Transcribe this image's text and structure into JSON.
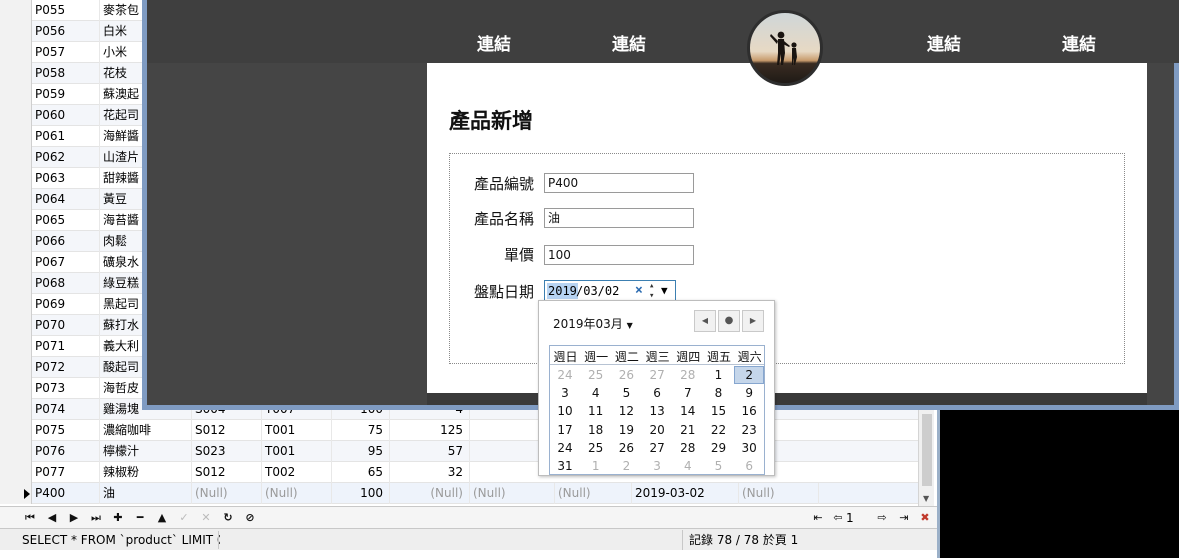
{
  "db_grid": {
    "rows": [
      {
        "id": "P055",
        "name": "麥茶包"
      },
      {
        "id": "P056",
        "name": "白米"
      },
      {
        "id": "P057",
        "name": "小米"
      },
      {
        "id": "P058",
        "name": "花枝"
      },
      {
        "id": "P059",
        "name": "蘇澳起"
      },
      {
        "id": "P060",
        "name": "花起司"
      },
      {
        "id": "P061",
        "name": "海鮮醬"
      },
      {
        "id": "P062",
        "name": "山渣片"
      },
      {
        "id": "P063",
        "name": "甜辣醬"
      },
      {
        "id": "P064",
        "name": "黃豆"
      },
      {
        "id": "P065",
        "name": "海苔醬"
      },
      {
        "id": "P066",
        "name": "肉鬆"
      },
      {
        "id": "P067",
        "name": "礦泉水"
      },
      {
        "id": "P068",
        "name": "綠豆糕"
      },
      {
        "id": "P069",
        "name": "黑起司"
      },
      {
        "id": "P070",
        "name": "蘇打水"
      },
      {
        "id": "P071",
        "name": "義大利"
      },
      {
        "id": "P072",
        "name": "酸起司"
      },
      {
        "id": "P073",
        "name": "海哲皮"
      },
      {
        "id": "P074",
        "name": "雞湯塊",
        "c3": "S004",
        "c4": "T007",
        "c5": "100",
        "c6": "4"
      },
      {
        "id": "P075",
        "name": "濃縮咖啡",
        "c3": "S012",
        "c4": "T001",
        "c5": "75",
        "c6": "125"
      },
      {
        "id": "P076",
        "name": "檸檬汁",
        "c3": "S023",
        "c4": "T001",
        "c5": "95",
        "c6": "57"
      },
      {
        "id": "P077",
        "name": "辣椒粉",
        "c3": "S012",
        "c4": "T002",
        "c5": "65",
        "c6": "32"
      },
      {
        "id": "P400",
        "name": "油",
        "c3": "(Null)",
        "c4": "(Null)",
        "c5": "100",
        "c6": "(Null)",
        "c7": "(Null)",
        "c8": "(Null)",
        "c9": "2019-03-02",
        "c10": "(Null)"
      }
    ],
    "page_number": "1",
    "sql_text": "SELECT * FROM `product` LIMIT 0, :",
    "record_text": "記錄 78 / 78 於頁 1"
  },
  "browser": {
    "nav_links": [
      "連結",
      "連結",
      "連結",
      "連結"
    ],
    "form_title": "產品新增",
    "fields": {
      "product_id_label": "產品編號",
      "product_id_value": "P400",
      "product_name_label": "產品名稱",
      "product_name_value": "油",
      "price_label": "單價",
      "price_value": "100",
      "stock_date_label": "盤點日期",
      "stock_date_year": "2019",
      "stock_date_rest": "/03/02"
    }
  },
  "calendar": {
    "month_label": "2019年03月",
    "weekdays": [
      "週日",
      "週一",
      "週二",
      "週三",
      "週四",
      "週五",
      "週六"
    ],
    "weeks": [
      [
        "24",
        "25",
        "26",
        "27",
        "28",
        "1",
        "2"
      ],
      [
        "3",
        "4",
        "5",
        "6",
        "7",
        "8",
        "9"
      ],
      [
        "10",
        "11",
        "12",
        "13",
        "14",
        "15",
        "16"
      ],
      [
        "17",
        "18",
        "19",
        "20",
        "21",
        "22",
        "23"
      ],
      [
        "24",
        "25",
        "26",
        "27",
        "28",
        "29",
        "30"
      ],
      [
        "31",
        "1",
        "2",
        "3",
        "4",
        "5",
        "6"
      ]
    ],
    "selected_day": "2"
  },
  "colors": {
    "browser_border": "#7f9bc2",
    "nav_background": "#3f3f3f",
    "selected_day": "#c5d6ea"
  }
}
